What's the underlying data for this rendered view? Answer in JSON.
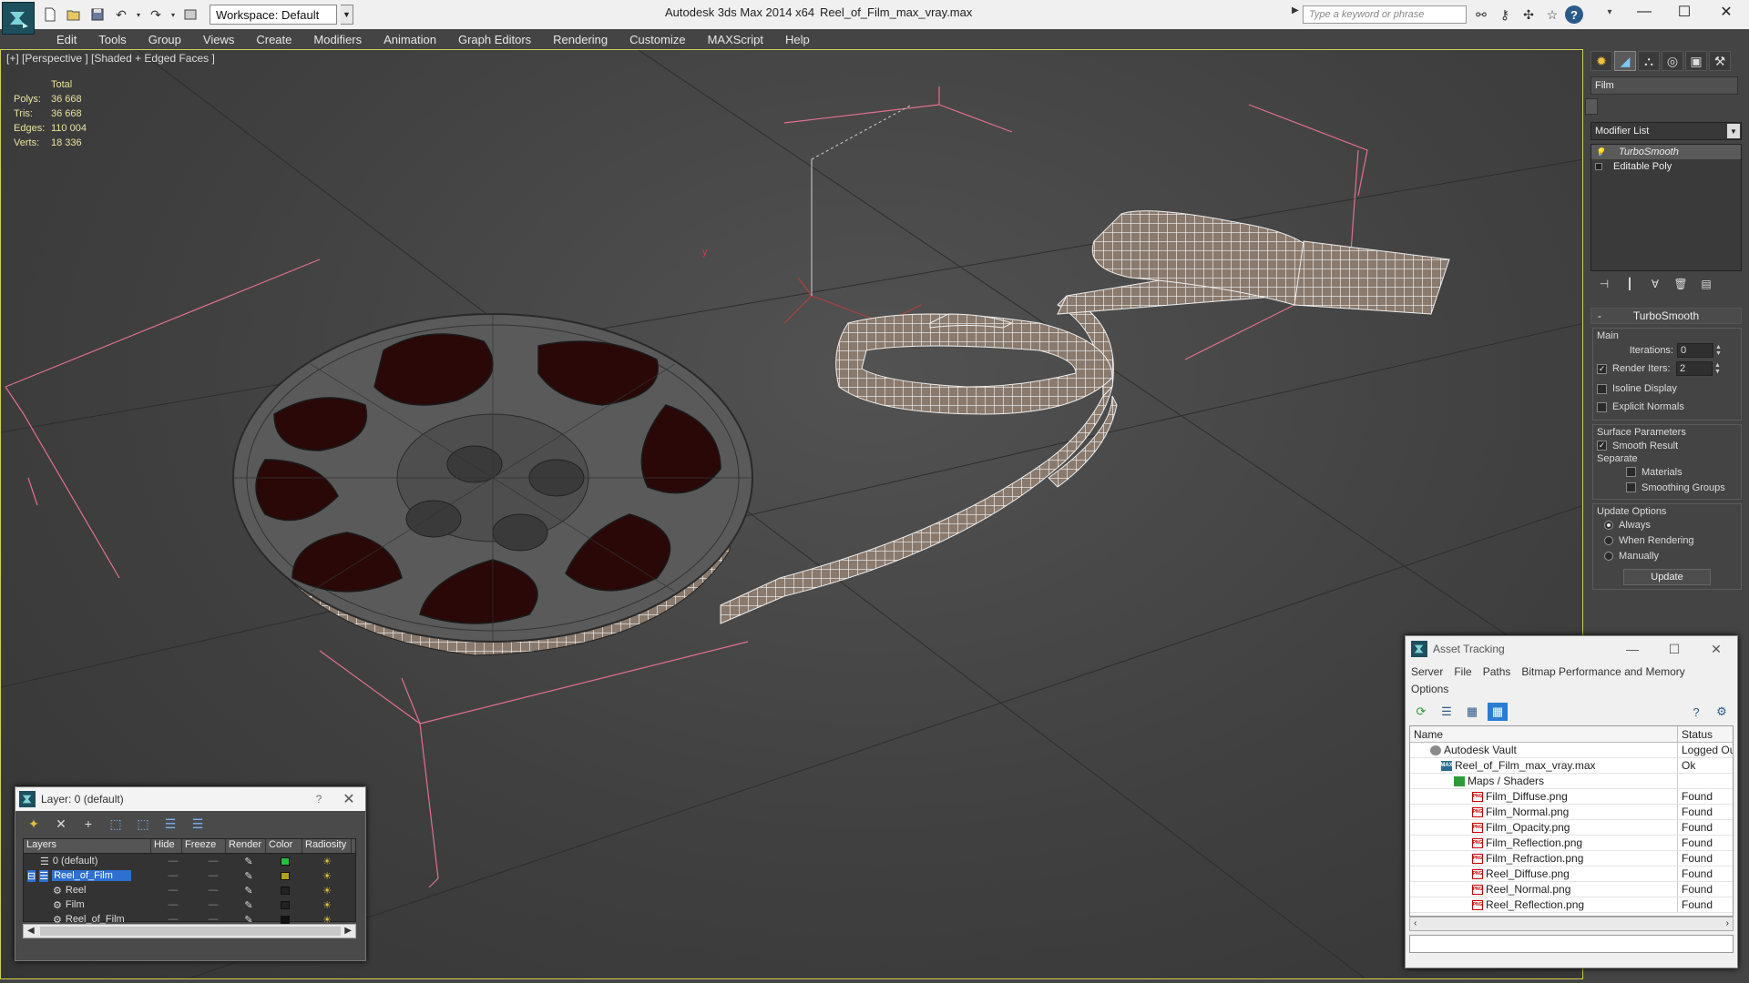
{
  "titlebar": {
    "workspace": "Workspace: Default",
    "app_title": "Autodesk 3ds Max  2014 x64",
    "file_title": "Reel_of_Film_max_vray.max",
    "search_placeholder": "Type a keyword or phrase"
  },
  "menu": [
    "Edit",
    "Tools",
    "Group",
    "Views",
    "Create",
    "Modifiers",
    "Animation",
    "Graph Editors",
    "Rendering",
    "Customize",
    "MAXScript",
    "Help"
  ],
  "viewport": {
    "label": "[+] [Perspective ] [Shaded + Edged Faces ]",
    "stats_header": "Total",
    "stats": [
      {
        "label": "Polys:",
        "value": "36 668"
      },
      {
        "label": "Tris:",
        "value": "36 668"
      },
      {
        "label": "Edges:",
        "value": "110 004"
      },
      {
        "label": "Verts:",
        "value": "18 336"
      }
    ],
    "stats_color": "#e9e3a0",
    "axis_label": "y"
  },
  "command_panel": {
    "object_name": "Film",
    "modifier_list": "Modifier List",
    "stack": [
      {
        "name": "TurboSmooth",
        "selected": true
      },
      {
        "name": "Editable Poly",
        "selected": false
      }
    ],
    "rollout_title": "TurboSmooth",
    "main_group": "Main",
    "iterations_label": "Iterations:",
    "iterations_value": "0",
    "render_iters_label": "Render Iters:",
    "render_iters_value": "2",
    "isoline_label": "Isoline Display",
    "explicit_normals_label": "Explicit Normals",
    "surface_params_group": "Surface Parameters",
    "smooth_result_label": "Smooth Result",
    "separate_label": "Separate",
    "materials_label": "Materials",
    "smoothing_groups_label": "Smoothing Groups",
    "update_options_group": "Update Options",
    "always_label": "Always",
    "when_rendering_label": "When Rendering",
    "manually_label": "Manually",
    "update_button": "Update"
  },
  "layer_dialog": {
    "title": "Layer: 0 (default)",
    "help": "?",
    "columns": [
      "Layers",
      "Hide",
      "Freeze",
      "Render",
      "Color",
      "Radiosity"
    ],
    "rows": [
      {
        "name": "0 (default)",
        "color": "#22c040",
        "selected": false,
        "indent": 0
      },
      {
        "name": "Reel_of_Film",
        "color": "#b0a020",
        "selected": true,
        "indent": 0
      },
      {
        "name": "Reel",
        "color": "#222222",
        "selected": false,
        "indent": 1
      },
      {
        "name": "Film",
        "color": "#222222",
        "selected": false,
        "indent": 1
      },
      {
        "name": "Reel_of_Film",
        "color": "#111111",
        "selected": false,
        "indent": 1
      }
    ]
  },
  "asset_dialog": {
    "title": "Asset Tracking",
    "menu": [
      "Server",
      "File",
      "Paths",
      "Bitmap Performance and Memory",
      "Options"
    ],
    "col_name": "Name",
    "col_status": "Status",
    "rows": [
      {
        "name": "Autodesk Vault",
        "status": "Logged Out",
        "icon": "vault",
        "indent": 0
      },
      {
        "name": "Reel_of_Film_max_vray.max",
        "status": "Ok",
        "icon": "max",
        "indent": 1
      },
      {
        "name": "Maps / Shaders",
        "status": "",
        "icon": "maps",
        "indent": 2
      },
      {
        "name": "Film_Diffuse.png",
        "status": "Found",
        "icon": "png",
        "indent": 3
      },
      {
        "name": "Film_Normal.png",
        "status": "Found",
        "icon": "png",
        "indent": 3
      },
      {
        "name": "Film_Opacity.png",
        "status": "Found",
        "icon": "png",
        "indent": 3
      },
      {
        "name": "Film_Reflection.png",
        "status": "Found",
        "icon": "png",
        "indent": 3
      },
      {
        "name": "Film_Refraction.png",
        "status": "Found",
        "icon": "png",
        "indent": 3
      },
      {
        "name": "Reel_Diffuse.png",
        "status": "Found",
        "icon": "png",
        "indent": 3
      },
      {
        "name": "Reel_Normal.png",
        "status": "Found",
        "icon": "png",
        "indent": 3
      },
      {
        "name": "Reel_Reflection.png",
        "status": "Found",
        "icon": "png",
        "indent": 3
      }
    ]
  },
  "colors": {
    "viewport_border": "#d0d050",
    "selection": "#2e6fd1",
    "brand": "#1d4f5c"
  }
}
